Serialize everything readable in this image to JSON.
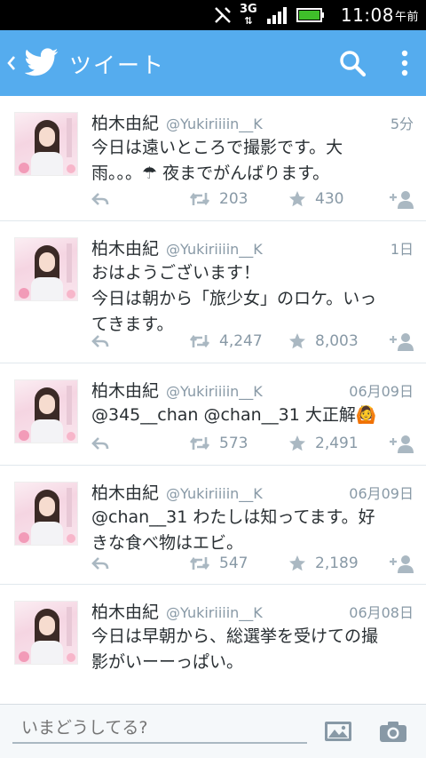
{
  "status_bar": {
    "network": "3G",
    "time": "11:08",
    "ampm": "午前"
  },
  "app_bar": {
    "title": "ツイート"
  },
  "tweets": [
    {
      "name": "柏木由紀",
      "handle": "@Yukiriiiin__K",
      "time": "5分",
      "text": "今日は遠いところで撮影です。大\n雨。。。☂ 夜までがんばります。",
      "retweets": "203",
      "favorites": "430"
    },
    {
      "name": "柏木由紀",
      "handle": "@Yukiriiiin__K",
      "time": "1日",
      "text": "おはようございます！\n今日は朝から「旅少女」のロケ。いっ\nてきます。",
      "retweets": "4,247",
      "favorites": "8,003"
    },
    {
      "name": "柏木由紀",
      "handle": "@Yukiriiiin__K",
      "time": "06月09日",
      "text": "@345__chan @chan__31 大正解🙆",
      "retweets": "573",
      "favorites": "2,491"
    },
    {
      "name": "柏木由紀",
      "handle": "@Yukiriiiin__K",
      "time": "06月09日",
      "text": "@chan__31 わたしは知ってます。好\nきな食べ物はエビ。",
      "retweets": "547",
      "favorites": "2,189"
    },
    {
      "name": "柏木由紀",
      "handle": "@Yukiriiiin__K",
      "time": "06月08日",
      "text": "今日は早朝から、総選挙を受けての撮\n影がいーーっぱい。\n\n本当に本当にありがとうございま",
      "retweets": "",
      "favorites": ""
    }
  ],
  "compose": {
    "placeholder": "いまどうしてる?"
  },
  "colors": {
    "accent": "#55acee",
    "muted": "#aab8c2"
  }
}
